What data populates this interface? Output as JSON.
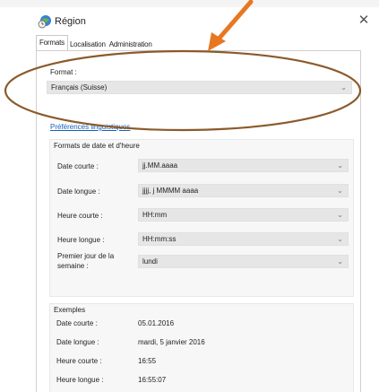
{
  "window": {
    "title": "Région",
    "close_glyph": "✕"
  },
  "tabs": [
    {
      "label": "Formats",
      "active": true
    },
    {
      "label": "Localisation",
      "active": false
    },
    {
      "label": "Administration",
      "active": false
    }
  ],
  "format": {
    "label": "Format :",
    "value": "Français (Suisse)"
  },
  "language_link": "Préférences linguistiques",
  "date_time_group": {
    "title": "Formats de date et d'heure",
    "rows": [
      {
        "label": "Date courte :",
        "value": "jj.MM.aaaa"
      },
      {
        "label": "Date longue :",
        "value": "jjjj, j MMMM aaaa"
      },
      {
        "label": "Heure courte :",
        "value": "HH:mm"
      },
      {
        "label": "Heure longue :",
        "value": "HH:mm:ss"
      },
      {
        "label": "Premier jour de la semaine :",
        "value": "lundi"
      }
    ]
  },
  "examples": {
    "title": "Exemples",
    "rows": [
      {
        "label": "Date courte :",
        "value": "05.01.2016"
      },
      {
        "label": "Date longue :",
        "value": "mardi, 5 janvier 2016"
      },
      {
        "label": "Heure courte :",
        "value": "16:55"
      },
      {
        "label": "Heure longue :",
        "value": "16:55:07"
      }
    ]
  },
  "colors": {
    "accent_link": "#1560bd",
    "annotation": "#e87722",
    "oval": "#8b5a2b"
  },
  "icons": {
    "window": "globe-clock-icon",
    "dropdown": "chevron-down-icon"
  }
}
